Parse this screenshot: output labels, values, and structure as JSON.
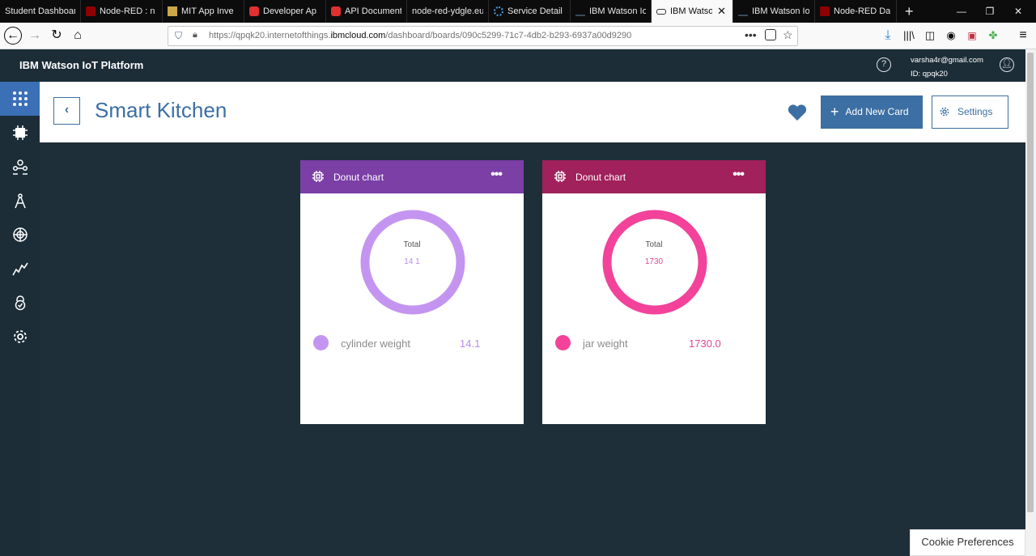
{
  "browser": {
    "tabs": [
      {
        "label": "Student Dashboard",
        "icon": "none",
        "active": false
      },
      {
        "label": "Node-RED : n",
        "icon": "node-red-icon",
        "active": false
      },
      {
        "label": "MIT App Inve",
        "icon": "mit-app-inventor-icon",
        "active": false
      },
      {
        "label": "Developer Ap",
        "icon": "developer-icon",
        "active": false
      },
      {
        "label": "API Document",
        "icon": "api-icon",
        "active": false
      },
      {
        "label": "node-red-ydgle.eu",
        "icon": "none",
        "active": false
      },
      {
        "label": "Service Detail",
        "icon": "loading-icon",
        "active": false
      },
      {
        "label": "IBM Watson Io",
        "icon": "ibm-icon",
        "active": false
      },
      {
        "label": "IBM Watson",
        "icon": "ibm-iot-icon",
        "active": true
      },
      {
        "label": "IBM Watson Io",
        "icon": "ibm-icon",
        "active": false
      },
      {
        "label": "Node-RED Da",
        "icon": "node-red-icon",
        "active": false
      }
    ],
    "url_prefix": "https://qpqk20.internetofthings.",
    "url_domain": "ibmcloud.com",
    "url_path": "/dashboard/boards/090c5299-71c7-4db2-b293-6937a00d9290",
    "window_controls": {
      "minimize": "—",
      "restore": "❐",
      "close": "✕"
    }
  },
  "app": {
    "title": "IBM Watson IoT Platform",
    "user_email": "varsha4r@gmail.com",
    "user_id": "ID: qpqk20"
  },
  "sidebar": {
    "items": [
      {
        "icon": "apps-grid-icon",
        "active": true
      },
      {
        "icon": "devices-chip-icon",
        "active": false
      },
      {
        "icon": "members-icon",
        "active": false
      },
      {
        "icon": "apps-compass-icon",
        "active": false
      },
      {
        "icon": "extensions-icon",
        "active": false
      },
      {
        "icon": "usage-chart-icon",
        "active": false
      },
      {
        "icon": "security-lock-icon",
        "active": false
      },
      {
        "icon": "settings-gear-icon",
        "active": false
      }
    ]
  },
  "page": {
    "title": "Smart Kitchen",
    "back": "‹",
    "add_card_label": "Add New Card",
    "settings_label": "Settings"
  },
  "cards": [
    {
      "title": "Donut chart",
      "menu": "•••",
      "header_color": "#7b3fa6",
      "ring_color": "#c495f0",
      "total_label": "Total",
      "total_value": "14 1",
      "legend_name": "cylinder weight",
      "legend_value": "14.1",
      "value_color": "#b78ce8"
    },
    {
      "title": "Donut chart",
      "menu": "•••",
      "header_color": "#a0215c",
      "ring_color": "#f2429a",
      "total_label": "Total",
      "total_value": "1730",
      "legend_name": "jar weight",
      "legend_value": "1730.0",
      "value_color": "#e04795"
    }
  ],
  "cookie": {
    "label": "Cookie Preferences"
  }
}
